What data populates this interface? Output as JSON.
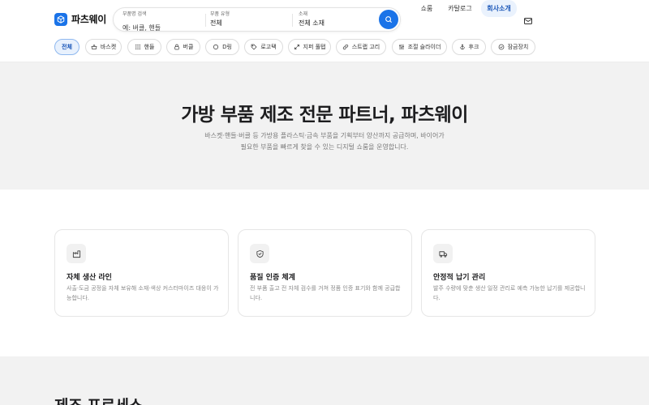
{
  "header": {
    "logo_text": "파츠웨이",
    "search": {
      "field1_label": "부품명 검색",
      "field1_placeholder": "예: 버클, 핸들",
      "field2_label": "부품 유형",
      "field2_value": "전체",
      "field3_label": "소재",
      "field3_value": "전체 소재"
    },
    "nav": [
      {
        "label": "쇼룸",
        "active": false
      },
      {
        "label": "카탈로그",
        "active": false
      },
      {
        "label": "회사소개",
        "active": true
      }
    ]
  },
  "categories": [
    {
      "label": "전체",
      "icon": "none",
      "active": true
    },
    {
      "label": "바스켓",
      "icon": "basket-icon",
      "active": false
    },
    {
      "label": "핸들",
      "icon": "grid-icon",
      "active": false
    },
    {
      "label": "버클",
      "icon": "lock-icon",
      "active": false
    },
    {
      "label": "D링",
      "icon": "ring-icon",
      "active": false
    },
    {
      "label": "로고택",
      "icon": "tag-icon",
      "active": false
    },
    {
      "label": "지퍼 풀탭",
      "icon": "expand-icon",
      "active": false
    },
    {
      "label": "스트랩 고리",
      "icon": "link-icon",
      "active": false
    },
    {
      "label": "조절 슬라이더",
      "icon": "slider-icon",
      "active": false
    },
    {
      "label": "후크",
      "icon": "anchor-icon",
      "active": false
    },
    {
      "label": "잠금장치",
      "icon": "shield-check-icon",
      "active": false
    }
  ],
  "hero": {
    "title": "가방 부품 제조 전문 파트너, 파츠웨이",
    "desc_line1": "바스켓·핸들·버클 등 가방용 플라스틱·금속 부품을 기획부터 양산까지 공급하며, 바이어가",
    "desc_line2": "필요한 부품을 빠르게 찾을 수 있는 디지털 쇼룸을 운영합니다."
  },
  "features": [
    {
      "icon": "factory-icon",
      "title": "자체 생산 라인",
      "desc": "사출·도금 공정을 자체 보유해 소재·색상 커스터마이즈 대응이 가능합니다."
    },
    {
      "icon": "shield-icon",
      "title": "품질 인증 체계",
      "desc": "전 부품 출고 전 자체 검수를 거쳐 정품 인증 표기와 함께 공급합니다."
    },
    {
      "icon": "truck-icon",
      "title": "안정적 납기 관리",
      "desc": "발주 수량에 맞춘 생산 일정 관리로 예측 가능한 납기를 제공합니다."
    }
  ],
  "process": {
    "title": "제조 프로세스"
  },
  "colors": {
    "accent": "#1a73e8",
    "hero_bg": "#f2f2f2"
  }
}
